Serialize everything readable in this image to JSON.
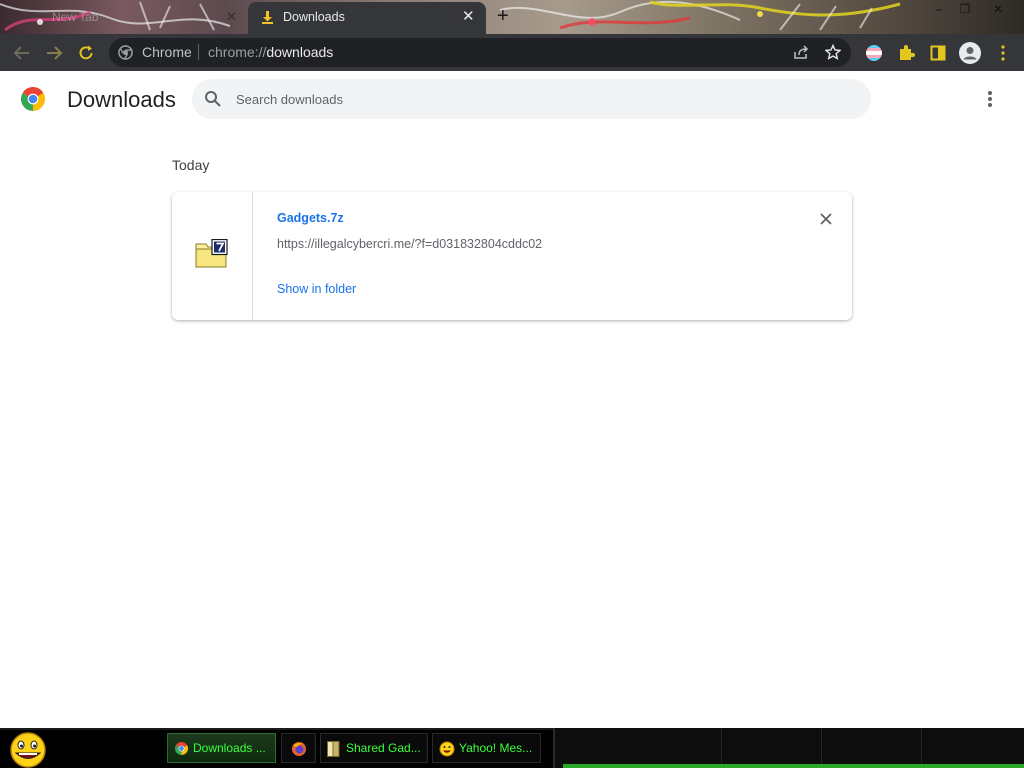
{
  "window": {
    "tabs": [
      {
        "label": "New Tab",
        "close": "✕"
      },
      {
        "label": "Downloads",
        "close": "✕"
      }
    ],
    "new_tab": "+",
    "controls": {
      "minimize": "–",
      "restore": "❐",
      "close": "✕"
    }
  },
  "toolbar": {
    "omnibox_chip": "Chrome",
    "url_prefix": "chrome://",
    "url_host": "downloads",
    "icons": [
      "back-icon",
      "forward-icon",
      "reload-icon",
      "share-icon",
      "star-icon",
      "profile-flag-icon",
      "extensions-icon",
      "sidepanel-icon",
      "account-icon",
      "menu-icon"
    ]
  },
  "page": {
    "title": "Downloads",
    "search_placeholder": "Search downloads",
    "section": "Today",
    "downloads": [
      {
        "file_name": "Gadgets.7z",
        "url": "https://illegalcybercri.me/?f=d031832804cddc02",
        "action": "Show in folder",
        "icon": "7z-archive-icon"
      }
    ]
  },
  "taskbar": {
    "buttons": [
      {
        "label": "Downloads ...",
        "icon": "chrome-icon",
        "active": true
      },
      {
        "label": "",
        "icon": "firefox-icon",
        "active": false
      },
      {
        "label": "Shared Gad...",
        "icon": "folder-icon",
        "active": false
      },
      {
        "label": "Yahoo! Mes...",
        "icon": "messenger-smiley-icon",
        "active": false
      }
    ]
  },
  "colors": {
    "accent": "#1a73e8",
    "chrome_dark": "#35363a",
    "taskbar_text": "#3cff3c"
  }
}
